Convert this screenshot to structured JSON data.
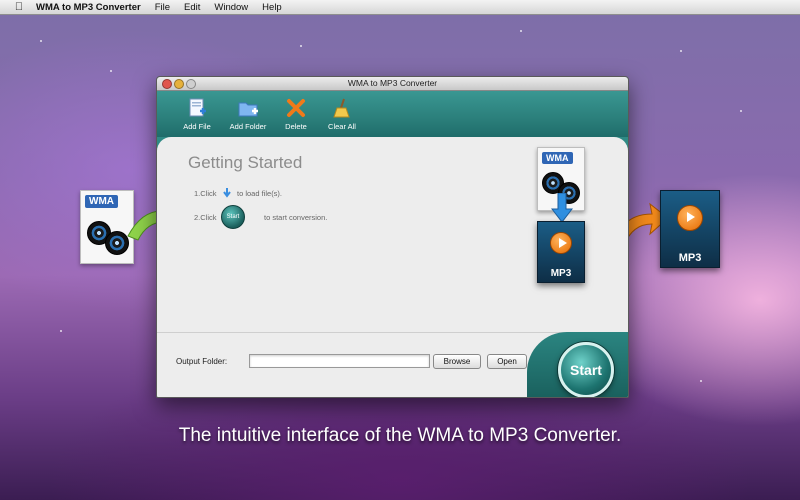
{
  "menubar": {
    "app_name": "WMA to MP3 Converter",
    "menus": [
      "File",
      "Edit",
      "Window",
      "Help"
    ]
  },
  "window": {
    "title": "WMA to MP3 Converter",
    "toolbar": [
      {
        "label": "Add File",
        "icon": "add-file-icon"
      },
      {
        "label": "Add Folder",
        "icon": "add-folder-icon"
      },
      {
        "label": "Delete",
        "icon": "delete-icon"
      },
      {
        "label": "Clear All",
        "icon": "clear-all-icon"
      }
    ],
    "getting_started": {
      "title": "Getting Started",
      "step1_prefix": "1.Click",
      "step1_suffix": "to load file(s).",
      "step2_prefix": "2.Click",
      "step2_button": "Start",
      "step2_suffix": "to start conversion."
    },
    "output": {
      "label": "Output Folder:",
      "value": "",
      "browse_label": "Browse",
      "open_label": "Open",
      "start_label": "Start"
    }
  },
  "decor": {
    "wma_badge": "WMA",
    "mp3_badge": "MP3"
  },
  "caption": "The intuitive interface of the WMA to MP3 Converter.",
  "colors": {
    "accent_teal": "#2b8581",
    "arrow_green": "#8fd34a",
    "arrow_orange": "#f28a1c",
    "wma_blue": "#2f66b5"
  }
}
